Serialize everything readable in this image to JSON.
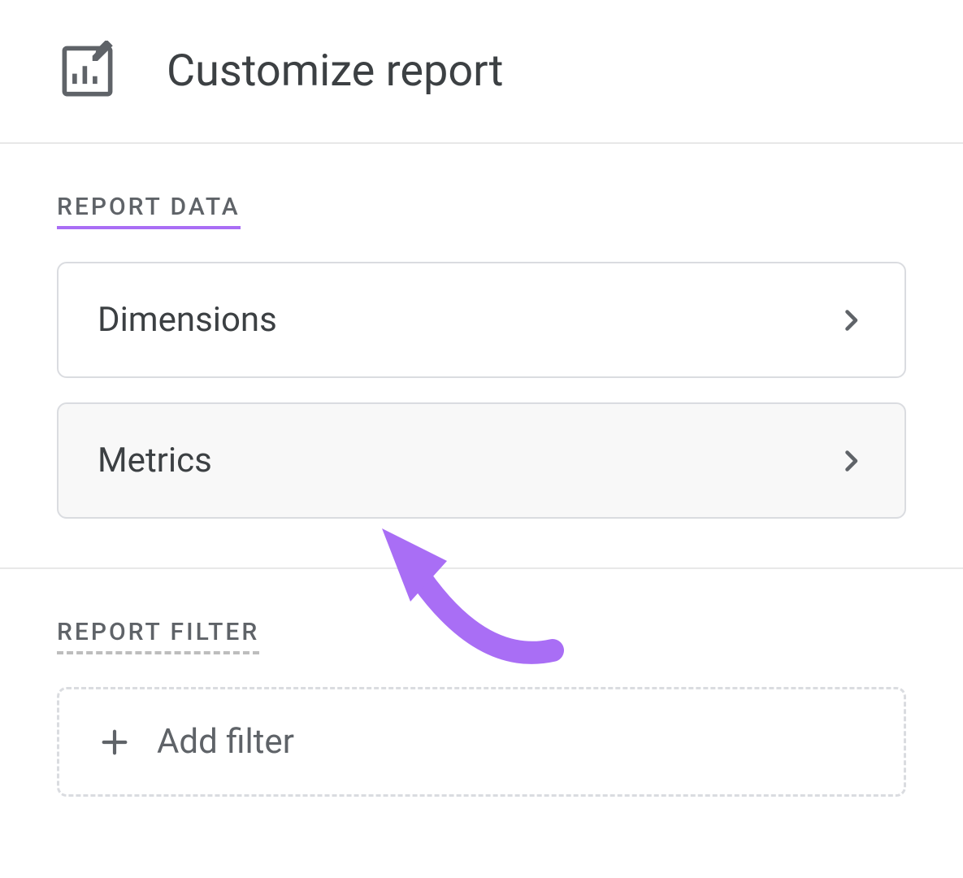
{
  "header": {
    "title": "Customize report"
  },
  "sections": {
    "report_data": {
      "label": "REPORT DATA",
      "options": [
        {
          "label": "Dimensions"
        },
        {
          "label": "Metrics"
        }
      ]
    },
    "report_filter": {
      "label": "REPORT FILTER",
      "add_filter_label": "Add filter"
    }
  },
  "colors": {
    "accent": "#a96ef5",
    "text_primary": "#3c4043",
    "text_secondary": "#5f6368",
    "border": "#dadce0"
  }
}
